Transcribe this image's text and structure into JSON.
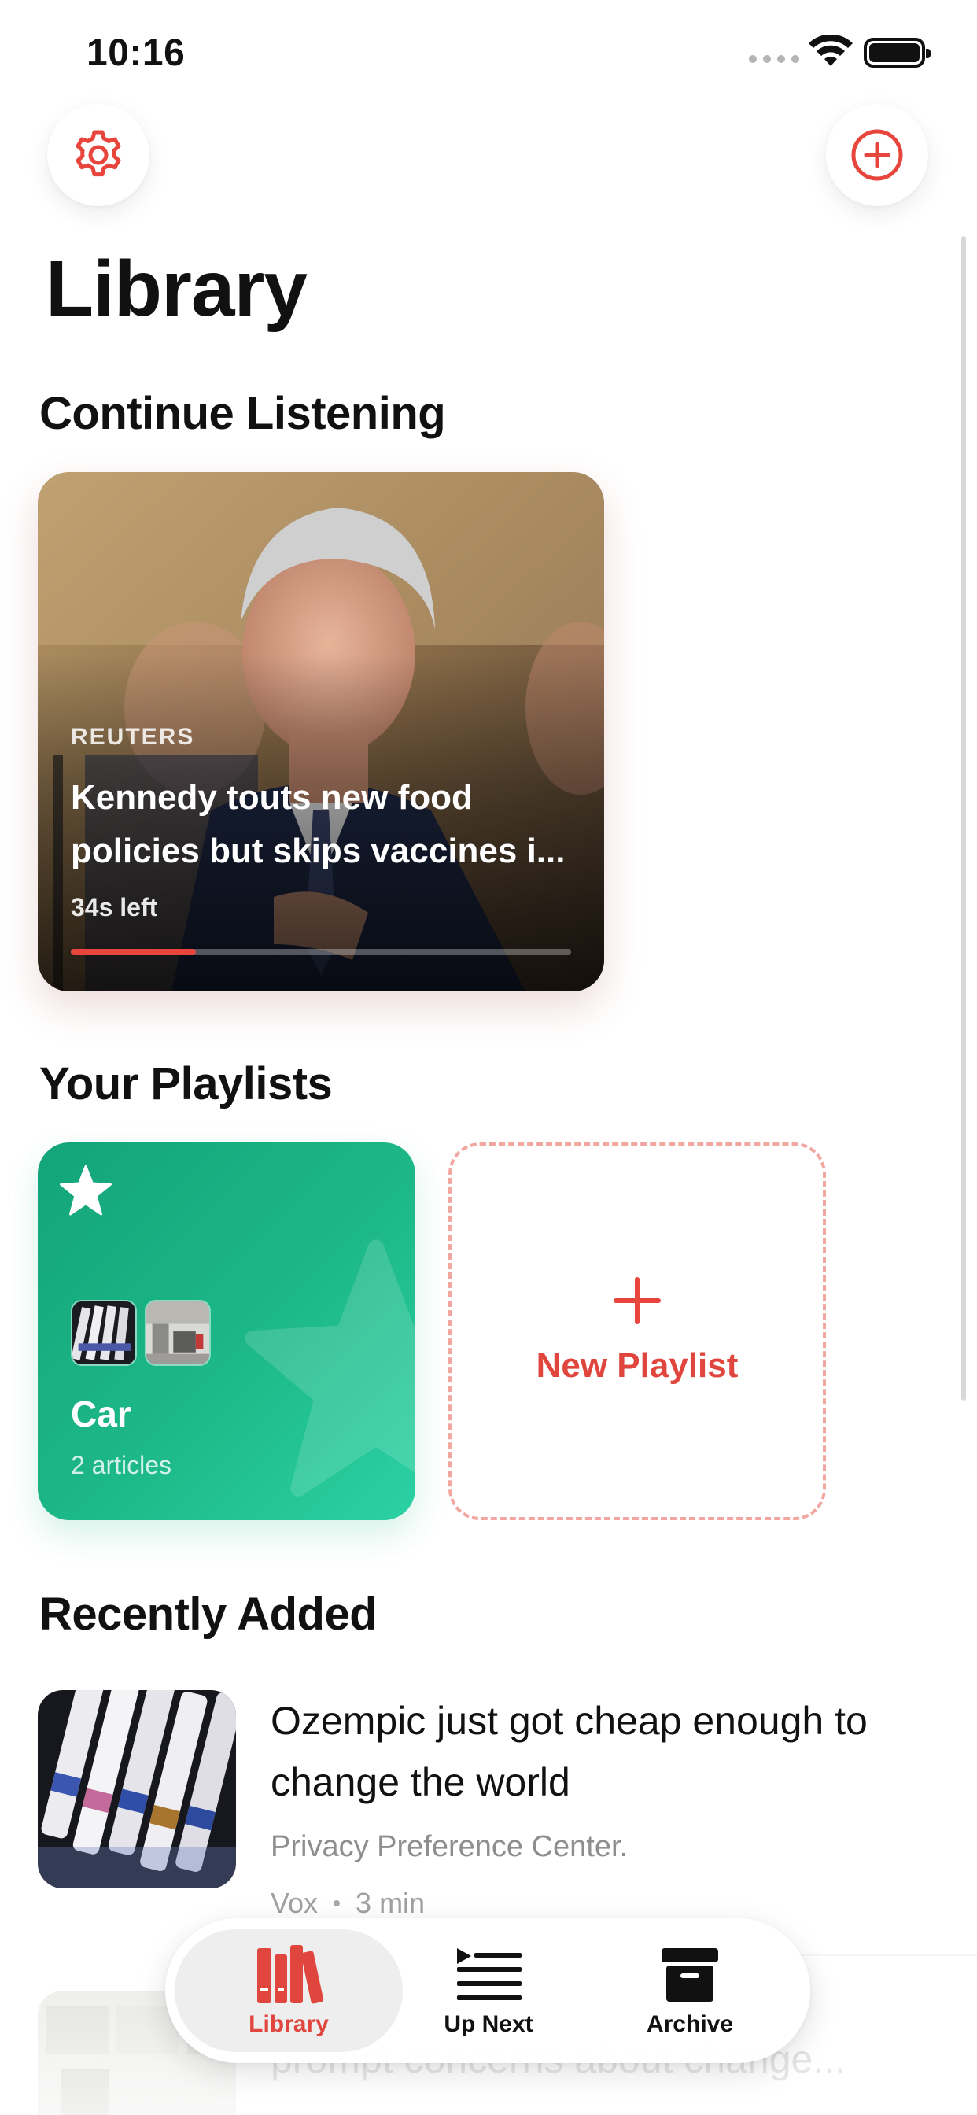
{
  "status_bar": {
    "time": "10:16"
  },
  "header": {
    "title": "Library",
    "settings_icon": "gear-icon",
    "add_icon": "plus-circle-icon"
  },
  "continue_listening": {
    "section_title": "Continue Listening",
    "card": {
      "source": "REUTERS",
      "title": "Kennedy touts new food policies but skips vaccines i...",
      "time_left": "34s left",
      "progress_fraction": 0.25
    }
  },
  "playlists": {
    "section_title": "Your Playlists",
    "items": [
      {
        "name": "Car",
        "count": "2 articles",
        "icon": "star-icon"
      }
    ],
    "new_playlist_label": "New Playlist"
  },
  "recently_added": {
    "section_title": "Recently Added",
    "items": [
      {
        "title": "Ozempic just got cheap enough to change the world",
        "description": "Privacy Preference Center.",
        "source": "Vox",
        "duration": "3 min"
      },
      {
        "title": "prompt concerns about change..."
      }
    ]
  },
  "tab_bar": {
    "tabs": [
      {
        "label": "Library",
        "icon": "library-books-icon",
        "active": true
      },
      {
        "label": "Up Next",
        "icon": "queue-list-icon",
        "active": false
      },
      {
        "label": "Archive",
        "icon": "archive-box-icon",
        "active": false
      }
    ]
  },
  "colors": {
    "accent": "#e8453c",
    "playlist_green": "#1db887",
    "text_primary": "#111111",
    "text_secondary": "#8e8e8e"
  }
}
